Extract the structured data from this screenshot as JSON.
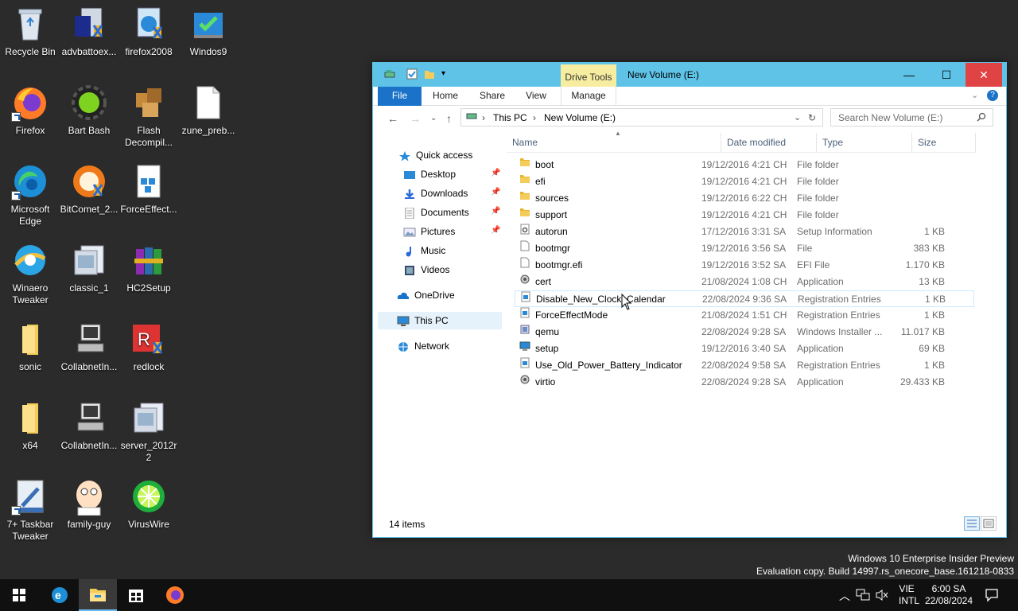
{
  "desktop_icons": [
    {
      "label": "Recycle Bin"
    },
    {
      "label": "advbattoex..."
    },
    {
      "label": "firefox2008"
    },
    {
      "label": "Windos9"
    },
    {
      "label": "Firefox"
    },
    {
      "label": "Bart Bash"
    },
    {
      "label": "Flash Decompil..."
    },
    {
      "label": "zune_preb..."
    },
    {
      "label": "Microsoft Edge"
    },
    {
      "label": "BitComet_2..."
    },
    {
      "label": "ForceEffect..."
    },
    {
      "label": "Winaero Tweaker"
    },
    {
      "label": "classic_1"
    },
    {
      "label": "HC2Setup"
    },
    {
      "label": "sonic"
    },
    {
      "label": "CollabnetIn..."
    },
    {
      "label": "redlock"
    },
    {
      "label": "x64"
    },
    {
      "label": "CollabnetIn..."
    },
    {
      "label": "server_2012r2"
    },
    {
      "label": "7+ Taskbar Tweaker"
    },
    {
      "label": "family-guy"
    },
    {
      "label": "VirusWire"
    }
  ],
  "window": {
    "title": "New Volume (E:)",
    "context_tab": "Drive Tools",
    "controls": {
      "minimize": "—",
      "maximize": "☐",
      "close": "✕"
    },
    "ribbon_tabs": [
      "File",
      "Home",
      "Share",
      "View",
      "Manage"
    ],
    "address": {
      "root": "This PC",
      "current": "New Volume (E:)"
    },
    "search_placeholder": "Search New Volume (E:)",
    "nav": {
      "quick_access": "Quick access",
      "desktop": "Desktop",
      "downloads": "Downloads",
      "documents": "Documents",
      "pictures": "Pictures",
      "music": "Music",
      "videos": "Videos",
      "onedrive": "OneDrive",
      "thispc": "This PC",
      "network": "Network"
    },
    "columns": {
      "name": "Name",
      "date": "Date modified",
      "type": "Type",
      "size": "Size"
    },
    "files": [
      {
        "name": "boot",
        "date": "19/12/2016 4:21 CH",
        "type": "File folder",
        "size": "",
        "icon": "folder-icon"
      },
      {
        "name": "efi",
        "date": "19/12/2016 4:21 CH",
        "type": "File folder",
        "size": "",
        "icon": "folder-icon"
      },
      {
        "name": "sources",
        "date": "19/12/2016 6:22 CH",
        "type": "File folder",
        "size": "",
        "icon": "folder-icon"
      },
      {
        "name": "support",
        "date": "19/12/2016 4:21 CH",
        "type": "File folder",
        "size": "",
        "icon": "folder-icon"
      },
      {
        "name": "autorun",
        "date": "17/12/2016 3:31 SA",
        "type": "Setup Information",
        "size": "1 KB",
        "icon": "settings-file-icon"
      },
      {
        "name": "bootmgr",
        "date": "19/12/2016 3:56 SA",
        "type": "File",
        "size": "383 KB",
        "icon": "file-icon"
      },
      {
        "name": "bootmgr.efi",
        "date": "19/12/2016 3:52 SA",
        "type": "EFI File",
        "size": "1.170 KB",
        "icon": "file-icon"
      },
      {
        "name": "cert",
        "date": "21/08/2024 1:08 CH",
        "type": "Application",
        "size": "13 KB",
        "icon": "application-icon"
      },
      {
        "name": "Disable_New_Clock_Calendar",
        "date": "22/08/2024 9:36 SA",
        "type": "Registration Entries",
        "size": "1 KB",
        "icon": "registry-icon"
      },
      {
        "name": "ForceEffectMode",
        "date": "21/08/2024 1:51 CH",
        "type": "Registration Entries",
        "size": "1 KB",
        "icon": "registry-icon"
      },
      {
        "name": "qemu",
        "date": "22/08/2024 9:28 SA",
        "type": "Windows Installer ...",
        "size": "11.017 KB",
        "icon": "installer-icon"
      },
      {
        "name": "setup",
        "date": "19/12/2016 3:40 SA",
        "type": "Application",
        "size": "69 KB",
        "icon": "setup-icon"
      },
      {
        "name": "Use_Old_Power_Battery_Indicator",
        "date": "22/08/2024 9:58 SA",
        "type": "Registration Entries",
        "size": "1 KB",
        "icon": "registry-icon"
      },
      {
        "name": "virtio",
        "date": "22/08/2024 9:28 SA",
        "type": "Application",
        "size": "29.433 KB",
        "icon": "application-icon"
      }
    ],
    "status": "14 items"
  },
  "watermark": {
    "line1": "Windows 10 Enterprise Insider Preview",
    "line2": "Evaluation copy. Build 14997.rs_onecore_base.161218-0833"
  },
  "taskbar": {
    "lang": "VIE",
    "layout": "INTL",
    "time": "6:00 SA",
    "date": "22/08/2024"
  },
  "colors": {
    "titlebar": "#5fc3e7",
    "file_tab": "#1a73c8",
    "close_button": "#e04343",
    "drive_tools": "#f7eda0",
    "folder": "#f4cc5a",
    "taskbar": "#101010",
    "desktop": "#2b2b2b"
  }
}
